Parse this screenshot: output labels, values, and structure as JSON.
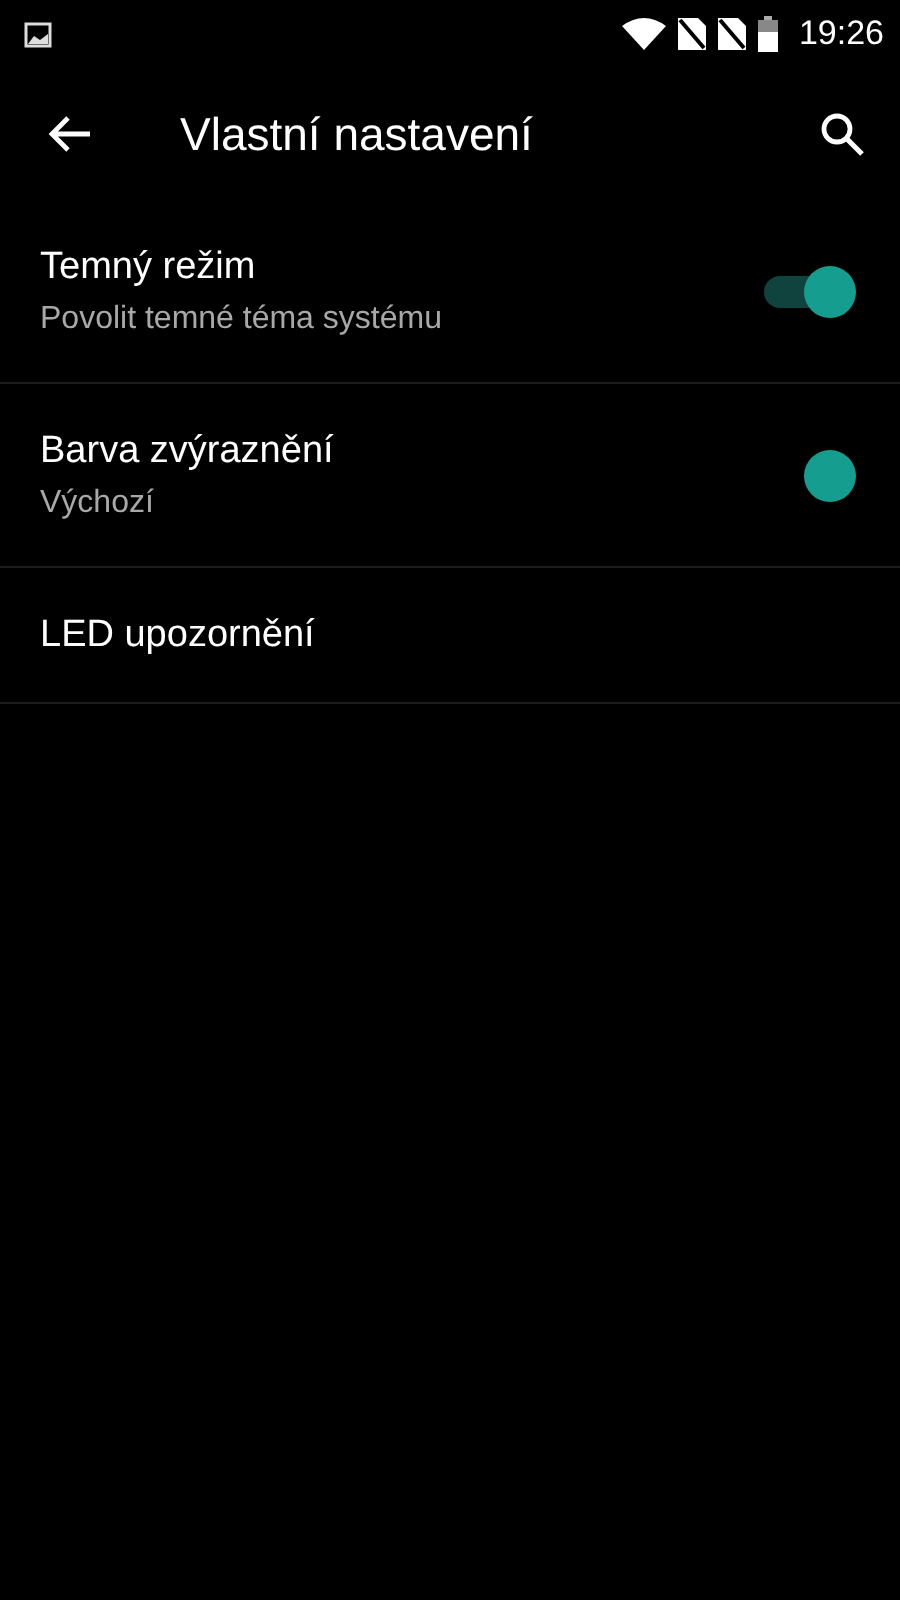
{
  "status_bar": {
    "time": "19:26"
  },
  "toolbar": {
    "title": "Vlastní nastavení"
  },
  "items": [
    {
      "kind": "toggle",
      "title": "Temný režim",
      "subtitle": "Povolit temné téma systému",
      "on": true
    },
    {
      "kind": "color",
      "title": "Barva zvýraznění",
      "subtitle": "Výchozí",
      "color": "#159e8f"
    },
    {
      "kind": "plain",
      "title": "LED upozornění"
    }
  ]
}
